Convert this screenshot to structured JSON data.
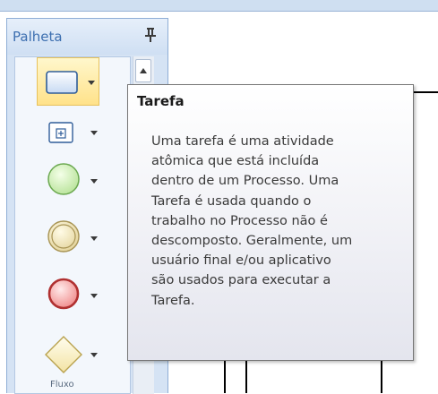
{
  "palette": {
    "title": "Palheta",
    "footer_label": "Fluxo",
    "tools": [
      {
        "icon": "task-rectangle-icon",
        "selected": true
      },
      {
        "icon": "subprocess-icon",
        "selected": false
      },
      {
        "icon": "start-event-icon",
        "selected": false
      },
      {
        "icon": "intermediate-event-icon",
        "selected": false
      },
      {
        "icon": "end-event-icon",
        "selected": false
      },
      {
        "icon": "gateway-diamond-icon",
        "selected": false
      }
    ]
  },
  "tooltip": {
    "title": "Tarefa",
    "body": "Uma tarefa é uma atividade\natômica que está incluída\ndentro de um Processo. Uma\nTarefa é usada quando o\ntrabalho no Processo não é\ndescomposto. Geralmente, um\nusuário final e/ou aplicativo\nsão usados para executar a\nTarefa."
  },
  "colors": {
    "palette_bg": "#d5e3f4",
    "title_blue": "#3d6fb0",
    "selected_bg": "#ffe28a"
  }
}
